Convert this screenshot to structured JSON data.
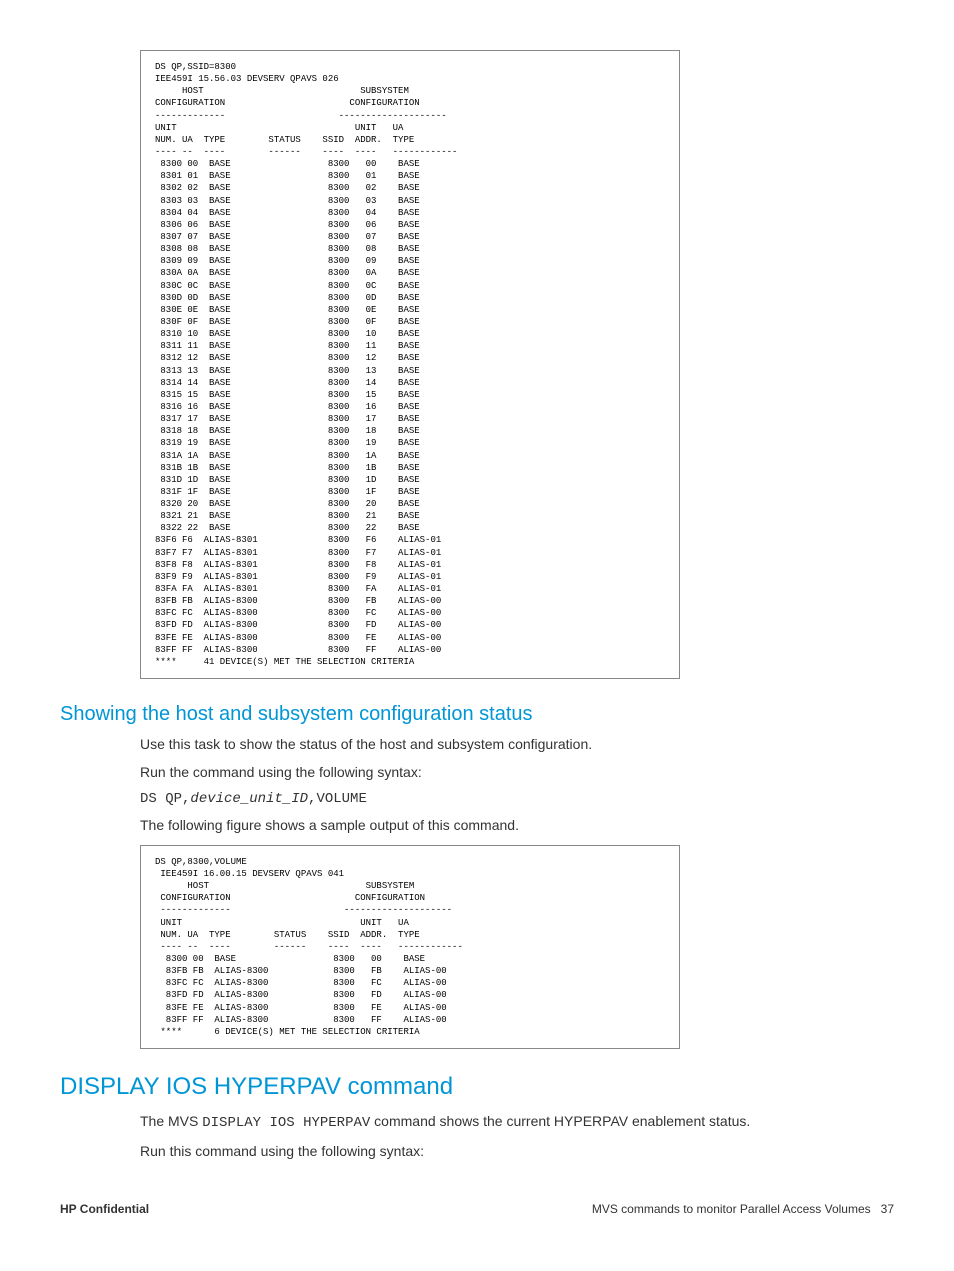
{
  "figure1": {
    "lines": [
      "DS QP,SSID=8300",
      "IEE459I 15.56.03 DEVSERV QPAVS 026",
      "     HOST                             SUBSYSTEM",
      "CONFIGURATION                       CONFIGURATION",
      "-------------                     --------------------",
      "UNIT                                 UNIT   UA",
      "NUM. UA  TYPE        STATUS    SSID  ADDR.  TYPE",
      "---- --  ----        ------    ----  ----   ------------",
      " 8300 00  BASE                  8300   00    BASE",
      " 8301 01  BASE                  8300   01    BASE",
      " 8302 02  BASE                  8300   02    BASE",
      " 8303 03  BASE                  8300   03    BASE",
      " 8304 04  BASE                  8300   04    BASE",
      " 8306 06  BASE                  8300   06    BASE",
      " 8307 07  BASE                  8300   07    BASE",
      " 8308 08  BASE                  8300   08    BASE",
      " 8309 09  BASE                  8300   09    BASE",
      " 830A 0A  BASE                  8300   0A    BASE",
      " 830C 0C  BASE                  8300   0C    BASE",
      " 830D 0D  BASE                  8300   0D    BASE",
      " 830E 0E  BASE                  8300   0E    BASE",
      " 830F 0F  BASE                  8300   0F    BASE",
      " 8310 10  BASE                  8300   10    BASE",
      " 8311 11  BASE                  8300   11    BASE",
      " 8312 12  BASE                  8300   12    BASE",
      " 8313 13  BASE                  8300   13    BASE",
      " 8314 14  BASE                  8300   14    BASE",
      " 8315 15  BASE                  8300   15    BASE",
      " 8316 16  BASE                  8300   16    BASE",
      " 8317 17  BASE                  8300   17    BASE",
      " 8318 18  BASE                  8300   18    BASE",
      " 8319 19  BASE                  8300   19    BASE",
      " 831A 1A  BASE                  8300   1A    BASE",
      " 831B 1B  BASE                  8300   1B    BASE",
      " 831D 1D  BASE                  8300   1D    BASE",
      " 831F 1F  BASE                  8300   1F    BASE",
      " 8320 20  BASE                  8300   20    BASE",
      " 8321 21  BASE                  8300   21    BASE",
      " 8322 22  BASE                  8300   22    BASE",
      "83F6 F6  ALIAS-8301             8300   F6    ALIAS-01",
      "83F7 F7  ALIAS-8301             8300   F7    ALIAS-01",
      "83F8 F8  ALIAS-8301             8300   F8    ALIAS-01",
      "83F9 F9  ALIAS-8301             8300   F9    ALIAS-01",
      "83FA FA  ALIAS-8301             8300   FA    ALIAS-01",
      "83FB FB  ALIAS-8300             8300   FB    ALIAS-00",
      "83FC FC  ALIAS-8300             8300   FC    ALIAS-00",
      "83FD FD  ALIAS-8300             8300   FD    ALIAS-00",
      "83FE FE  ALIAS-8300             8300   FE    ALIAS-00",
      "83FF FF  ALIAS-8300             8300   FF    ALIAS-00",
      "****     41 DEVICE(S) MET THE SELECTION CRITERIA"
    ]
  },
  "section1": {
    "heading": "Showing the host and subsystem configuration status",
    "para1": "Use this task to show the status of the host and subsystem configuration.",
    "para2": "Run the command using the following syntax:",
    "cmd_pre": "DS QP,",
    "cmd_italic": "device_unit_ID",
    "cmd_post": ",VOLUME",
    "para3": "The following figure shows a sample output of this command."
  },
  "figure2": {
    "lines": [
      "DS QP,8300,VOLUME",
      " IEE459I 16.00.15 DEVSERV QPAVS 041",
      "      HOST                             SUBSYSTEM",
      " CONFIGURATION                       CONFIGURATION",
      " -------------                     --------------------",
      " UNIT                                 UNIT   UA",
      " NUM. UA  TYPE        STATUS    SSID  ADDR.  TYPE",
      " ---- --  ----        ------    ----  ----   ------------",
      "  8300 00  BASE                  8300   00    BASE",
      "  83FB FB  ALIAS-8300            8300   FB    ALIAS-00",
      "  83FC FC  ALIAS-8300            8300   FC    ALIAS-00",
      "  83FD FD  ALIAS-8300            8300   FD    ALIAS-00",
      "  83FE FE  ALIAS-8300            8300   FE    ALIAS-00",
      "  83FF FF  ALIAS-8300            8300   FF    ALIAS-00",
      " ****      6 DEVICE(S) MET THE SELECTION CRITERIA"
    ]
  },
  "section2": {
    "heading": "DISPLAY IOS HYPERPAV command",
    "para1_pre": "The MVS ",
    "para1_mono": "DISPLAY IOS HYPERPAV",
    "para1_post": " command shows the current HYPERPAV enablement status.",
    "para2": "Run this command using the following syntax:"
  },
  "footer": {
    "left": "HP Confidential",
    "right_text": "MVS commands to monitor Parallel Access Volumes",
    "page": "37"
  }
}
